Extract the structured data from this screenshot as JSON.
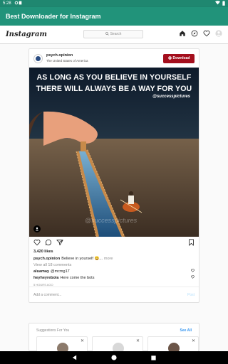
{
  "status_bar": {
    "time": "5:28"
  },
  "app_bar": {
    "title": "Best Downloader for Instagram"
  },
  "instagram": {
    "logo": "Instagram",
    "search_placeholder": "Search"
  },
  "post": {
    "username": "psych.opinion",
    "location": "The United States of America",
    "download_label": "Download",
    "image": {
      "line1": "AS LONG AS YOU BELIEVE IN YOURSELF",
      "line2": "THERE WILL ALWAYS BE A WAY FOR YOU",
      "handle": "@successpictures",
      "watermark": "@successpictures"
    },
    "likes": "3,420 likes",
    "caption_user": "psych.opinion",
    "caption_text": "Believe in yourself 😀...",
    "caption_more": "more",
    "view_comments": "View all 18 comments",
    "comments": [
      {
        "user": "aluamay",
        "text": "@mcmg17"
      },
      {
        "user": "heyheyrebola",
        "text": "Here come the bots"
      }
    ],
    "date": "5 HOURS AGO",
    "add_comment_placeholder": "Add a comment...",
    "post_label": "Post"
  },
  "suggestions": {
    "title": "Suggestions For You",
    "see_all": "See All",
    "close_glyph": "✕"
  }
}
